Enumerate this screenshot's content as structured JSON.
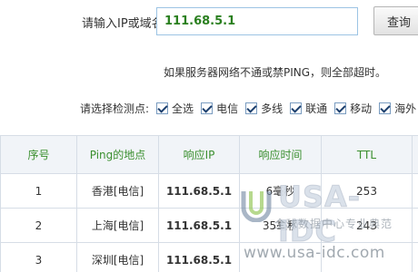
{
  "query": {
    "label": "请输入IP或域名:",
    "value": "111.68.5.1",
    "button": "查询"
  },
  "notice": "如果服务器网络不通或禁PING，则全部超时。",
  "nodes": {
    "label": "请选择检测点:",
    "items": [
      {
        "label": "全选",
        "checked": true
      },
      {
        "label": "电信",
        "checked": true
      },
      {
        "label": "多线",
        "checked": true
      },
      {
        "label": "联通",
        "checked": true
      },
      {
        "label": "移动",
        "checked": true
      },
      {
        "label": "海外",
        "checked": true
      }
    ],
    "help_icon": "help-icon"
  },
  "table": {
    "headers": [
      "序号",
      "Ping的地点",
      "响应IP",
      "响应时间",
      "TTL"
    ],
    "rows": [
      {
        "no": "1",
        "location": "香港[电信]",
        "ip": "111.68.5.1",
        "time": "6毫秒",
        "ttl": "253"
      },
      {
        "no": "2",
        "location": "上海[电信]",
        "ip": "111.68.5.1",
        "time": "35毫秒",
        "ttl": "243"
      },
      {
        "no": "3",
        "location": "深圳[电信]",
        "ip": "111.68.5.1",
        "time": "",
        "ttl": ""
      }
    ]
  },
  "watermark": {
    "brand": "USA-IDC",
    "subtitle": "全球数据中心专业典范",
    "url": "www.usa-idc.com"
  },
  "colors": {
    "ip_green": "#2a8f22",
    "header_green": "#3a8f2e",
    "input_border": "#9cc4e4"
  }
}
